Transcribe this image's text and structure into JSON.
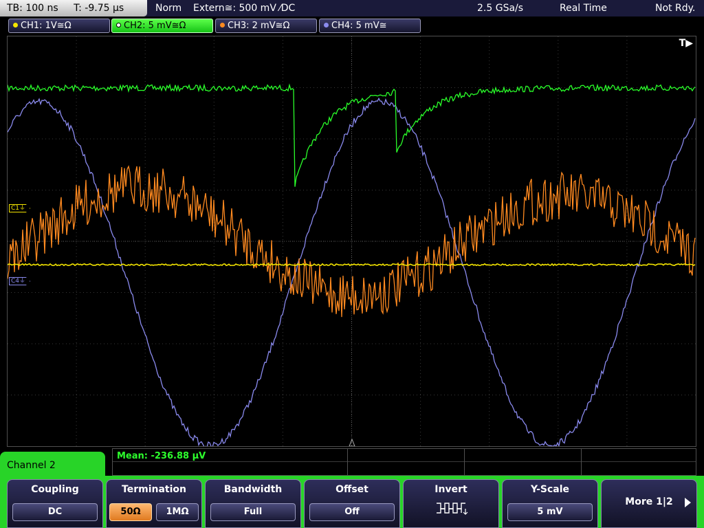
{
  "status": {
    "timebase": "TB: 100 ns",
    "trigger_time": "T: -9.75 µs",
    "mode": "Norm",
    "trigger_source": "Extern≅: 500 mV ⁄DC",
    "sample_rate": "2.5 GSa/s",
    "acquisition": "Real Time",
    "state": "Not Rdy."
  },
  "channels": [
    {
      "label": "CH1: 1V≅Ω",
      "color": "#f5e600"
    },
    {
      "label": "CH2: 5 mV≅Ω",
      "color": "#1fd31f"
    },
    {
      "label": "CH3: 2 mV≅Ω",
      "color": "#ff8a20"
    },
    {
      "label": "CH4: 5 mV≅",
      "color": "#8080ff"
    }
  ],
  "markers": {
    "c1": "C1⏚",
    "c4": "C4⏚",
    "trigger": "T▶"
  },
  "measurement": {
    "text": "Mean: -236.88 µV"
  },
  "menu": {
    "title": "Channel 2",
    "coupling": {
      "label": "Coupling",
      "value": "DC"
    },
    "termination": {
      "label": "Termination",
      "opt1": "50Ω",
      "opt2": "1MΩ"
    },
    "bandwidth": {
      "label": "Bandwidth",
      "value": "Full"
    },
    "offset": {
      "label": "Offset",
      "value": "Off"
    },
    "invert": {
      "label": "Invert"
    },
    "yscale": {
      "label": "Y-Scale",
      "value": "5 mV"
    },
    "more": {
      "label": "More 1|2"
    }
  },
  "colors": {
    "ch1": "#f5e600",
    "ch2": "#2aff2a",
    "ch3": "#ff8a20",
    "ch4": "#8a8aee",
    "menu_accent": "#28d428"
  }
}
